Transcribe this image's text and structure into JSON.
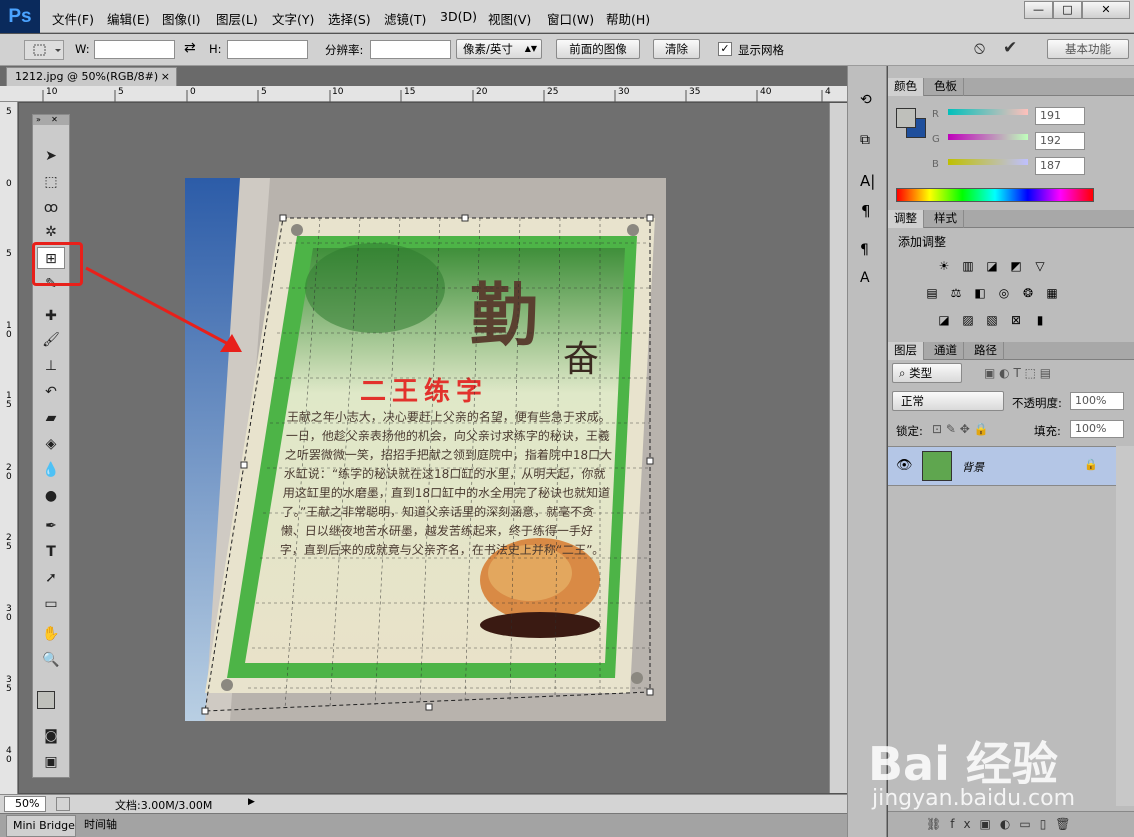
{
  "app": {
    "logo": "Ps"
  },
  "menu": [
    "文件(F)",
    "编辑(E)",
    "图像(I)",
    "图层(L)",
    "文字(Y)",
    "选择(S)",
    "滤镜(T)",
    "3D(D)",
    "视图(V)",
    "窗口(W)",
    "帮助(H)"
  ],
  "window_controls": {
    "minimize": "—",
    "maximize": "□",
    "close": "✕"
  },
  "options": {
    "w_label": "W:",
    "h_label": "H:",
    "swap": "⇄",
    "resolution_label": "分辨率:",
    "unit_select": "像素/英寸",
    "front_image": "前面的图像",
    "clear": "清除",
    "show_grid": "显示网格",
    "cancel_icon": "⦸",
    "commit_icon": "✔",
    "workspace": "基本功能"
  },
  "document": {
    "tab": "1212.jpg @ 50%(RGB/8#)",
    "tab_close": "×",
    "ruler_h": [
      "10",
      "5",
      "0",
      "5",
      "10",
      "15",
      "20",
      "25",
      "30",
      "35",
      "40",
      "4"
    ],
    "ruler_v": [
      "5",
      "0",
      "5",
      "1\n0",
      "1\n5",
      "2\n0",
      "2\n5",
      "3\n0",
      "3\n5",
      "4\n0"
    ]
  },
  "photo": {
    "big_char": "勤",
    "small_char": "奋",
    "title": "二王练字",
    "body": "王献之年小志大，决心要赶上父亲的名望，便有些急于求成。一日，他趁父亲表扬他的机会，向父亲讨求练字的秘诀，王羲之听罢微微一笑，招招手把献之领到庭院中，指着院中18口大水缸说：“练字的秘诀就在这18口缸的水里，从明天起，你就用这缸里的水磨墨，直到18口缸中的水全用完了秘诀也就知道了。”王献之非常聪明，知道父亲话里的深刻涵意，就毫不贪懒、日以继夜地苦水研墨，越发苦练起来，终于练得一手好字，直到后来的成就竟与父亲齐名，在书法史上并称“二王”。"
  },
  "status": {
    "zoom": "50%",
    "doc": "文档:3.00M/3.00M"
  },
  "bottom_tabs": [
    "Mini Bridge",
    "时间轴"
  ],
  "color_panel": {
    "tabs": [
      "颜色",
      "色板"
    ],
    "r_label": "R",
    "g_label": "G",
    "b_label": "B",
    "r": "191",
    "g": "192",
    "b": "187",
    "fg_color": "#bfc0bb",
    "bg_color": "#1f4f9c"
  },
  "adjust_panel": {
    "tabs": [
      "调整",
      "样式"
    ],
    "title": "添加调整"
  },
  "layers_panel": {
    "tabs": [
      "图层",
      "通道",
      "路径"
    ],
    "kind": "类型",
    "blend": "正常",
    "opacity_label": "不透明度:",
    "opacity": "100%",
    "lock_label": "锁定:",
    "fill_label": "填充:",
    "fill": "100%",
    "layer_name": "背景"
  },
  "watermark": {
    "brand": "Bai 经验",
    "url": "jingyan.baidu.com"
  },
  "colors": {
    "highlight_red": "#e8201a",
    "selection_blue": "#b4c6e6"
  }
}
